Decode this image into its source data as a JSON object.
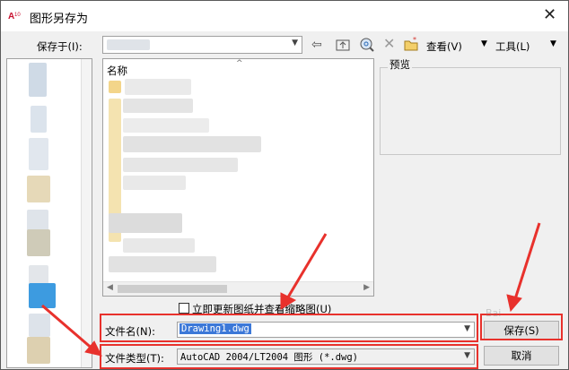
{
  "window": {
    "title": "图形另存为",
    "app_icon": "autocad-a10-icon",
    "close_glyph": "✕"
  },
  "toolbar": {
    "save_in_label": "保存于(I):",
    "save_in_value": "",
    "view_label": "查看(V)",
    "tools_label": "工具(L)",
    "icons": [
      "back-arrow-icon",
      "up-folder-icon",
      "search-web-icon",
      "delete-icon",
      "new-folder-icon"
    ]
  },
  "file_list": {
    "column_name": "名称",
    "sort_indicator": "^"
  },
  "preview": {
    "label": "预览"
  },
  "options": {
    "update_thumbnail_label": "立即更新图纸并查看缩略图(U)",
    "update_thumbnail_checked": false
  },
  "fields": {
    "filename_label": "文件名(N):",
    "filename_value": "Drawing1.dwg",
    "filetype_label": "文件类型(T):",
    "filetype_value": "AutoCAD 2004/LT2004 图形 (*.dwg)"
  },
  "buttons": {
    "save": "保存(S)",
    "cancel": "取消"
  },
  "colors": {
    "annotation_red": "#e8312c",
    "selection_blue": "#3c78d8",
    "dialog_bg": "#f0f0f0"
  }
}
